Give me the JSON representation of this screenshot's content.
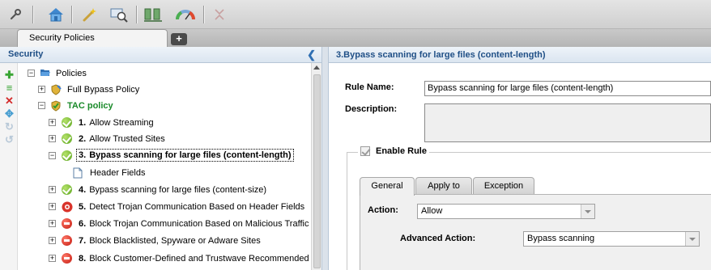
{
  "toolbar": {
    "icons": [
      "wrench-icon",
      "home-icon",
      "wand-icon",
      "network-search-icon",
      "servers-icon",
      "gauge-icon",
      "collapse-icon"
    ]
  },
  "tabs": {
    "active_label": "Security Policies",
    "add_label": "+"
  },
  "left_panel": {
    "title": "Security",
    "tree": {
      "root": "Policies",
      "full_bypass": "Full Bypass Policy",
      "tac": "TAC policy",
      "rules": [
        {
          "num": "1.",
          "label": "Allow Streaming",
          "status": "allow"
        },
        {
          "num": "2.",
          "label": "Allow Trusted Sites",
          "status": "allow"
        },
        {
          "num": "3.",
          "label": "Bypass scanning for large files (content-length)",
          "status": "allow"
        },
        {
          "num": "4.",
          "label": "Bypass scanning for large files (content-size)",
          "status": "allow"
        },
        {
          "num": "5.",
          "label": "Detect Trojan Communication Based on Header Fields",
          "status": "detect"
        },
        {
          "num": "6.",
          "label": "Block Trojan Communication Based on Malicious Traffic",
          "status": "block"
        },
        {
          "num": "7.",
          "label": "Block Blacklisted, Spyware or Adware Sites",
          "status": "block"
        },
        {
          "num": "8.",
          "label": "Block Customer-Defined and Trustwave Recommended ...",
          "status": "block"
        }
      ],
      "child_header_fields": "Header Fields"
    }
  },
  "right_panel": {
    "title": "3.Bypass scanning for large files (content-length)",
    "rule_name_label": "Rule Name:",
    "rule_name_value": "Bypass scanning for large files (content-length)",
    "description_label": "Description:",
    "description_value": "",
    "enable_rule_label": "Enable Rule",
    "inner_tabs": [
      "General",
      "Apply to",
      "Exception"
    ],
    "action_label": "Action:",
    "action_value": "Allow",
    "advanced_action_label": "Advanced Action:",
    "advanced_action_value": "Bypass scanning"
  }
}
